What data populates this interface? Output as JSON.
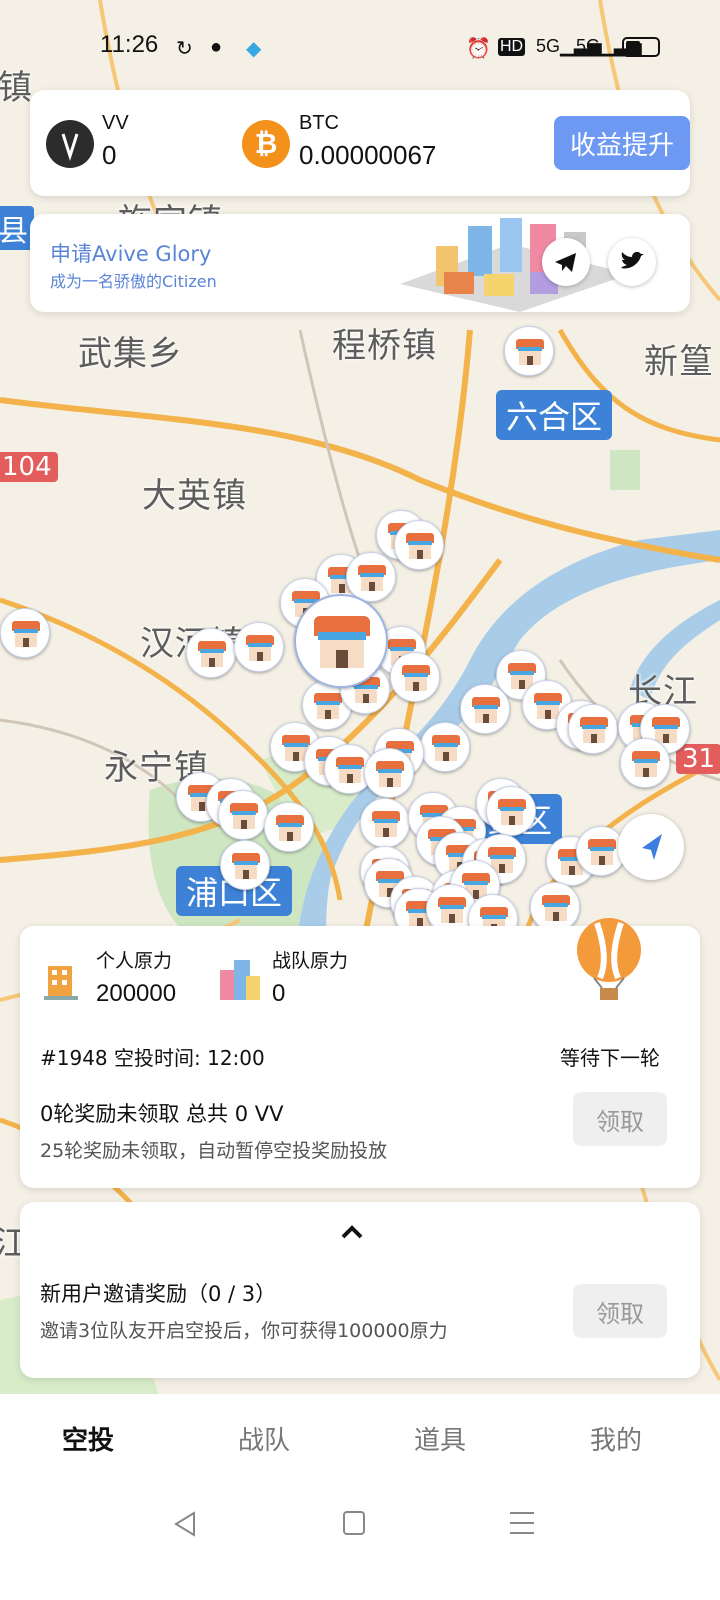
{
  "status_bar": {
    "time": "11:26",
    "icons": [
      "sync-icon",
      "wechat-icon",
      "shield-icon",
      "alarm-icon",
      "hd-icon",
      "5g-signal-icon",
      "5g-signal-icon",
      "battery-icon"
    ]
  },
  "map": {
    "places": [
      "镇",
      "旌宫镇",
      "县",
      "武集乡",
      "程桥镇",
      "新篁",
      "大英镇",
      "汉河镇",
      "长江",
      "永宁镇",
      "104",
      "31",
      "江"
    ],
    "districts": [
      "六合区",
      "浦口区",
      "鼓区"
    ]
  },
  "wallet": {
    "coin1": {
      "name": "VV",
      "value": "0"
    },
    "coin2": {
      "name": "BTC",
      "value": "0.00000067"
    },
    "boost_label": "收益提升"
  },
  "banner": {
    "line1": "申请Avive Glory",
    "line2": "成为一名骄傲的Citizen"
  },
  "airdrop": {
    "personal_label": "个人原力",
    "personal_value": "200000",
    "team_label": "战队原力",
    "team_value": "0",
    "round_text": "#1948 空投时间: 12:00",
    "wait_text": "等待下一轮",
    "unclaimed_title": "0轮奖励未领取 总共 0 VV",
    "unclaimed_note": "25轮奖励未领取，自动暂停空投奖励投放",
    "claim_label": "领取"
  },
  "invite": {
    "collapse_icon": "chevron-up-icon",
    "title": "新用户邀请奖励（0 / 3）",
    "note": "邀请3位队友开启空投后，你可获得100000原力",
    "claim_label": "领取"
  },
  "tabs": [
    {
      "label": "空投",
      "active": true
    },
    {
      "label": "战队",
      "active": false
    },
    {
      "label": "道具",
      "active": false
    },
    {
      "label": "我的",
      "active": false
    }
  ],
  "colors": {
    "accent": "#6e99f2",
    "district": "#3d82d6",
    "marker_roof": "#e86f3e"
  }
}
